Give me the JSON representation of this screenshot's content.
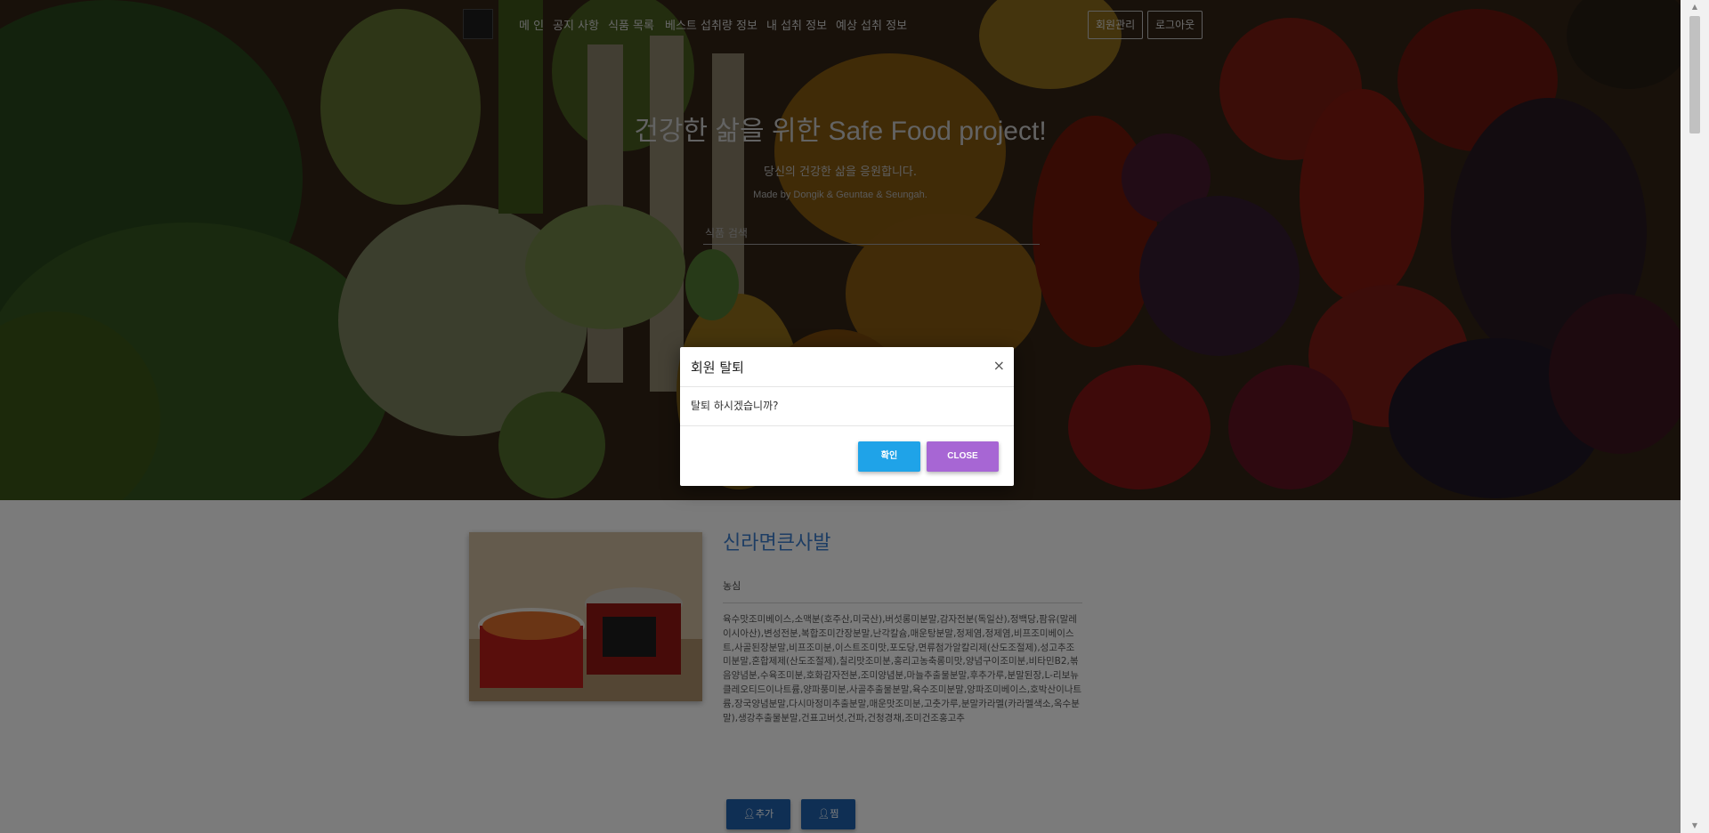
{
  "nav": {
    "items": [
      {
        "id": "main",
        "label": "메 인"
      },
      {
        "id": "notice",
        "label": "공지 사항"
      },
      {
        "id": "food-list",
        "label": "식품 목록"
      },
      {
        "id": "best-intake",
        "label": "베스트 섭취량 정보"
      },
      {
        "id": "my-intake",
        "label": "내 섭취 정보"
      },
      {
        "id": "expected-intake",
        "label": "예상 섭취 정보"
      }
    ],
    "member_manage_label": "회원관리",
    "logout_label": "로그아웃"
  },
  "hero": {
    "title": "건강한 삶을 위한 Safe Food project!",
    "subtitle": "당신의 건강한 삶을 응원합니다.",
    "credit": "Made by Dongik & Geuntae & Seungah.",
    "search_placeholder": "식품 검색"
  },
  "food": {
    "name": "신라면큰사발",
    "maker": "농심",
    "ingredients": "육수맛조미베이스,소맥분(호주산,미국산),버섯롱미분말,감자전분(독일산),정백당,팜유(말레이시아산),변성전분,복합조미간장분말,난각칼슘,매운탕분말,정제염,정제염,비프조미베이스트,사골된장분말,비프조미분,이스트조미맛,포도당,면류첨가알칼리제(산도조절제),성고추조미분말,혼합제제(산도조절제),칠리맛조미분,홍리고농축롱미맛,양념구이조미분,비타민B2,볶음양념분,수육조미분,호화감자전분,조미양념분,마늘추출물분말,후추가루,분말된장,L-리보뉴클레오티드이나트륨,양파풍미분,사골추출물분말,육수조미분말,양파조미베이스,호박산이나트륨,장국양념분말,다시마정미추출분말,매운맛조미분,고춧가루,분말카라멜(카라멜색소,옥수분말),생강추출물분말,건표고버섯,건파,건청경채,조미건조홍고추",
    "add_label": "추가",
    "zzim_label": "찜"
  },
  "modal": {
    "title": "회원 탈퇴",
    "close_x": "×",
    "message": "탈퇴 하시겠습니까?",
    "confirm_label": "확인",
    "close_label": "CLOSE"
  },
  "colors": {
    "link_blue": "#3a7ac8",
    "action_blue": "#1f5fa8",
    "confirm_blue": "#1fa3e8",
    "close_purple": "#a766d4"
  }
}
